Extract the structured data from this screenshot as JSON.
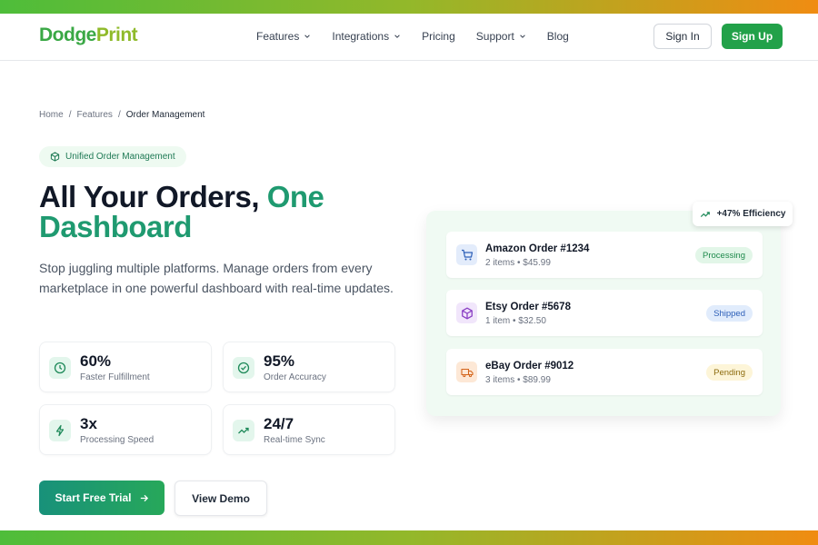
{
  "colors": {
    "brand": "#22a149",
    "accent": "#1f9a70",
    "stripe_start": "#4ebd3a",
    "stripe_end": "#f08c12"
  },
  "header": {
    "logo_part1": "Dodge",
    "logo_part2": "Print",
    "nav": [
      {
        "label": "Features",
        "dropdown": true
      },
      {
        "label": "Integrations",
        "dropdown": true
      },
      {
        "label": "Pricing",
        "dropdown": false
      },
      {
        "label": "Support",
        "dropdown": true
      },
      {
        "label": "Blog",
        "dropdown": false
      }
    ],
    "signin_label": "Sign In",
    "signup_label": "Sign Up"
  },
  "breadcrumb": {
    "home": "Home",
    "features": "Features",
    "current": "Order Management",
    "sep": "/"
  },
  "hero": {
    "pill": "Unified Order Management",
    "headline_part1": "All Your Orders, ",
    "headline_accent1": "One",
    "headline_accent2": "Dashboard",
    "subtext": "Stop juggling multiple platforms. Manage orders from every marketplace in one powerful dashboard with real-time updates."
  },
  "stats": [
    {
      "value": "60%",
      "label": "Faster Fulfillment",
      "icon": "clock-icon"
    },
    {
      "value": "95%",
      "label": "Order Accuracy",
      "icon": "check-circle-icon"
    },
    {
      "value": "3x",
      "label": "Processing Speed",
      "icon": "lightning-icon"
    },
    {
      "value": "24/7",
      "label": "Real-time Sync",
      "icon": "trending-up-icon"
    }
  ],
  "cta": {
    "primary": "Start Free Trial",
    "secondary": "View Demo"
  },
  "efficiency_badge": "+47% Efficiency",
  "orders": [
    {
      "name": "Amazon Order #1234",
      "details": "2 items • $45.99",
      "status": "Processing",
      "icon": "cart-icon"
    },
    {
      "name": "Etsy Order #5678",
      "details": "1 item • $32.50",
      "status": "Shipped",
      "icon": "box-icon"
    },
    {
      "name": "eBay Order #9012",
      "details": "3 items • $89.99",
      "status": "Pending",
      "icon": "truck-icon"
    }
  ]
}
